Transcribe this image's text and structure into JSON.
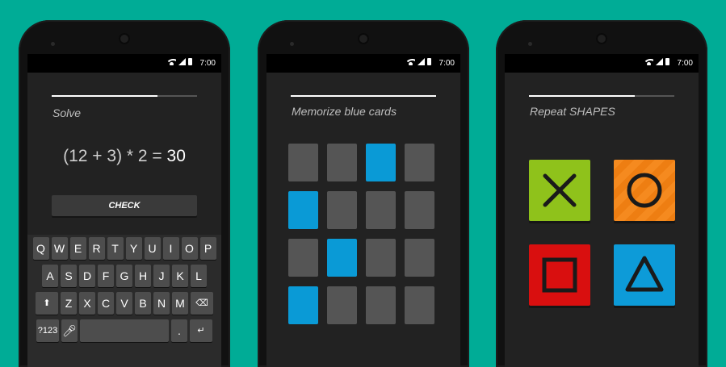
{
  "status": {
    "time": "7:00"
  },
  "phone1": {
    "task_label": "Solve",
    "equation_left": "(12 + 3) * 2 = ",
    "equation_answer": "30",
    "progress": 0.73,
    "check_button": "CHECK",
    "keyboard": {
      "row1": [
        "Q",
        "W",
        "E",
        "R",
        "T",
        "Y",
        "U",
        "I",
        "O",
        "P"
      ],
      "row2": [
        "A",
        "S",
        "D",
        "F",
        "G",
        "H",
        "J",
        "K",
        "L"
      ],
      "row3": [
        "Z",
        "X",
        "C",
        "V",
        "B",
        "N",
        "M"
      ],
      "mode_key": "?123",
      "dot_key": "."
    }
  },
  "phone2": {
    "task_label": "Memorize blue cards",
    "progress": 1.0,
    "cards": [
      [
        "gray",
        "gray",
        "blue",
        "gray"
      ],
      [
        "blue",
        "gray",
        "gray",
        "gray"
      ],
      [
        "gray",
        "blue",
        "gray",
        "gray"
      ],
      [
        "blue",
        "gray",
        "gray",
        "gray"
      ]
    ]
  },
  "phone3": {
    "task_label": "Repeat SHAPES",
    "progress": 0.73,
    "shapes": [
      "cross",
      "circle",
      "square",
      "triangle"
    ]
  },
  "colors": {
    "background": "#00ac96",
    "card_blue": "#0a9ad6",
    "card_gray": "#555555",
    "shape_green": "#8fc21b",
    "shape_orange": "#f58a1f",
    "shape_red": "#d90f0f",
    "shape_blue": "#0d9bd8"
  }
}
